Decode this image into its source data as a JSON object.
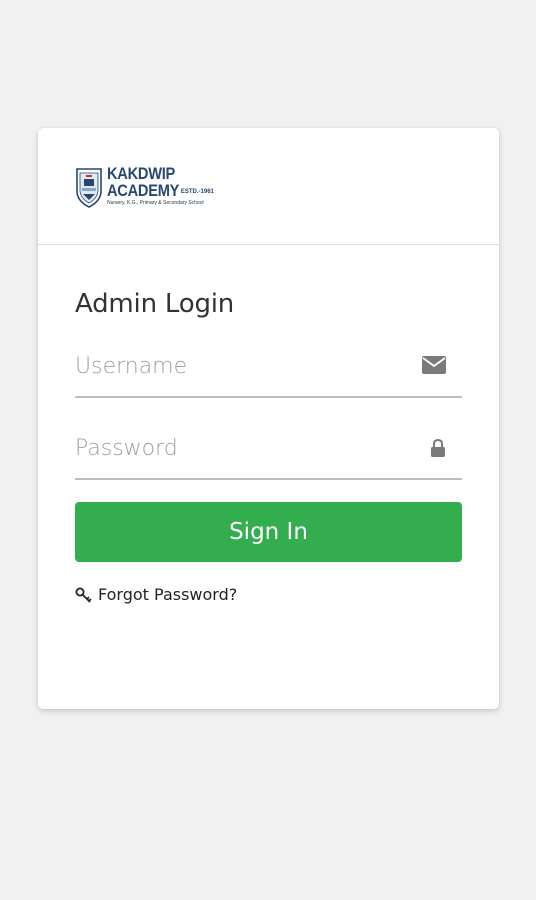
{
  "logo": {
    "line1": "KAKDWIP",
    "line2": "ACADEMY",
    "estd": "ESTD.-1961",
    "tagline": "Nursery, K.G., Primary & Secondary School"
  },
  "login": {
    "title": "Admin Login",
    "username_placeholder": "Username",
    "password_placeholder": "Password",
    "signin_label": "Sign In",
    "forgot_label": "Forgot Password?"
  },
  "icons": {
    "username": "envelope-icon",
    "password": "lock-icon",
    "forgot": "key-icon"
  },
  "colors": {
    "background": "#f1f1f1",
    "card": "#ffffff",
    "accent": "#33ad4d",
    "brand": "#27476f",
    "icon": "#7a7a7a"
  }
}
